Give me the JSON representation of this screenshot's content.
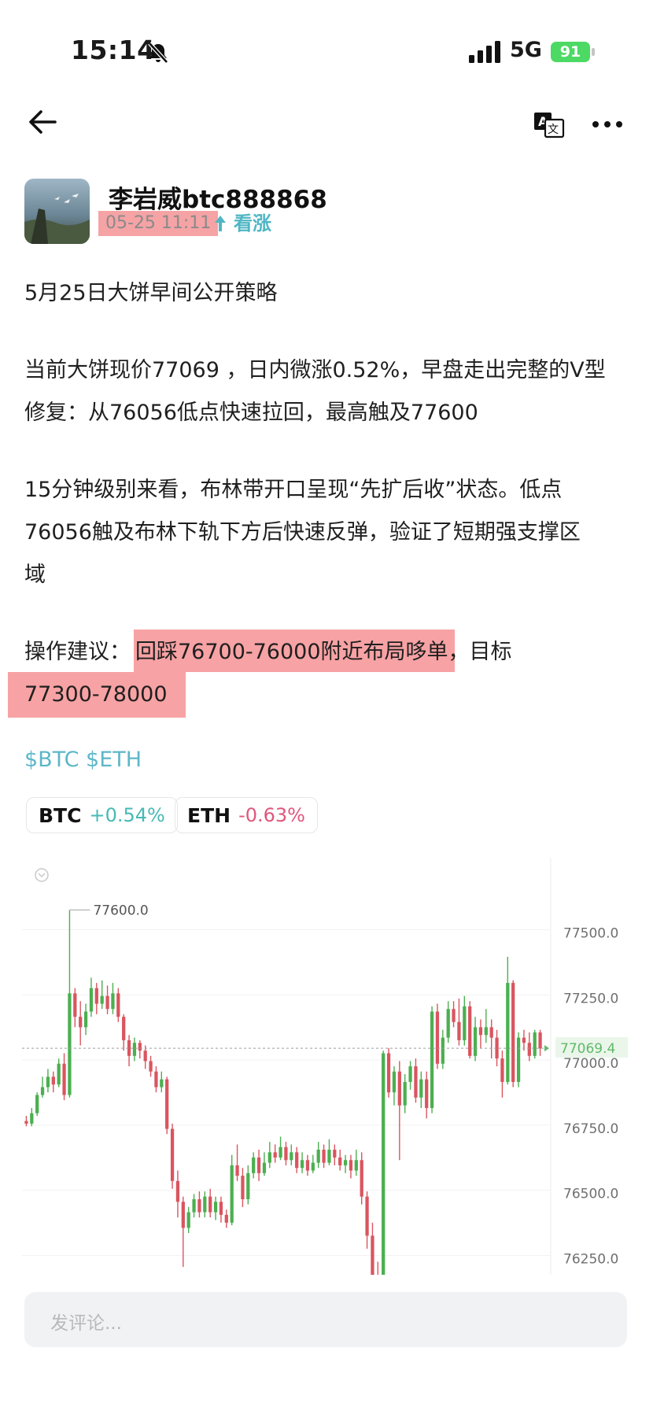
{
  "status_bar": {
    "time": "15:14",
    "network": "5G",
    "battery": "91"
  },
  "post": {
    "author": "李岩威btc888868",
    "time": "05-25 11:11",
    "sentiment": "看涨",
    "title_line": "5月25日大饼早间公开策略",
    "lines": [
      "当前大饼现价77069 ，日内微涨0.52%，早盘走出完整的V型",
      "修复：从76056低点快速拉回，最高触及77600",
      "15分钟级别来看，布林带开口呈现“先扩后收”状态。低点",
      "76056触及布林下轨下方后快速反弹，验证了短期强支撑区",
      "域"
    ],
    "advice_prefix": "操作建议：",
    "advice_highlight": "回踩76700-76000附近布局哆单",
    "advice_suffix": "，目标",
    "advice_target": "77300-78000",
    "tags": "$BTC $ETH"
  },
  "tickers": [
    {
      "symbol": "BTC",
      "change": "+0.54%"
    },
    {
      "symbol": "ETH",
      "change": "-0.63%"
    }
  ],
  "chart_data": {
    "type": "candlestick",
    "y_ticks": [
      "77500.0",
      "77250.0",
      "77000.0",
      "76750.0",
      "76500.0",
      "76250.0"
    ],
    "ylim": [
      76200,
      77740
    ],
    "high_label": "77600.0",
    "current_price_label": "77069.4",
    "colors": {
      "up": "#4caf50",
      "down": "#d9555f",
      "current": "#61b96a"
    },
    "candles": [
      [
        76790,
        76780,
        76810,
        76770
      ],
      [
        76780,
        76820,
        76840,
        76770
      ],
      [
        76820,
        76890,
        76900,
        76810
      ],
      [
        76890,
        76920,
        76960,
        76880
      ],
      [
        76920,
        76960,
        76990,
        76900
      ],
      [
        76960,
        76930,
        76980,
        76900
      ],
      [
        76930,
        77010,
        77030,
        76920
      ],
      [
        77010,
        76890,
        77050,
        76870
      ],
      [
        76890,
        77280,
        77600,
        76880
      ],
      [
        77280,
        77190,
        77300,
        77150
      ],
      [
        77190,
        77150,
        77250,
        77080
      ],
      [
        77150,
        77210,
        77240,
        77120
      ],
      [
        77210,
        77300,
        77340,
        77190
      ],
      [
        77300,
        77240,
        77320,
        77200
      ],
      [
        77240,
        77270,
        77330,
        77220
      ],
      [
        77270,
        77220,
        77310,
        77200
      ],
      [
        77220,
        77280,
        77320,
        77200
      ],
      [
        77280,
        77190,
        77300,
        77170
      ],
      [
        77190,
        77100,
        77200,
        77060
      ],
      [
        77100,
        77040,
        77120,
        77000
      ],
      [
        77040,
        77090,
        77110,
        77020
      ],
      [
        77090,
        77060,
        77100,
        77030
      ],
      [
        77060,
        77020,
        77080,
        76990
      ],
      [
        77020,
        76980,
        77040,
        76960
      ],
      [
        76980,
        76920,
        77000,
        76900
      ],
      [
        76920,
        76950,
        76980,
        76900
      ],
      [
        76950,
        76760,
        76960,
        76740
      ],
      [
        76760,
        76560,
        76780,
        76530
      ],
      [
        76560,
        76480,
        76600,
        76420
      ],
      [
        76480,
        76380,
        76500,
        76230
      ],
      [
        76380,
        76440,
        76460,
        76360
      ],
      [
        76440,
        76490,
        76510,
        76420
      ],
      [
        76490,
        76440,
        76520,
        76420
      ],
      [
        76440,
        76500,
        76520,
        76420
      ],
      [
        76500,
        76440,
        76530,
        76420
      ],
      [
        76440,
        76480,
        76500,
        76410
      ],
      [
        76480,
        76430,
        76500,
        76400
      ],
      [
        76430,
        76400,
        76450,
        76380
      ],
      [
        76400,
        76620,
        76660,
        76390
      ],
      [
        76620,
        76580,
        76700,
        76560
      ],
      [
        76580,
        76490,
        76610,
        76460
      ],
      [
        76490,
        76590,
        76620,
        76470
      ],
      [
        76590,
        76650,
        76670,
        76570
      ],
      [
        76650,
        76590,
        76680,
        76560
      ],
      [
        76590,
        76630,
        76670,
        76580
      ],
      [
        76630,
        76670,
        76710,
        76610
      ],
      [
        76670,
        76650,
        76700,
        76630
      ],
      [
        76650,
        76690,
        76730,
        76640
      ],
      [
        76690,
        76640,
        76710,
        76620
      ],
      [
        76640,
        76670,
        76700,
        76620
      ],
      [
        76670,
        76610,
        76690,
        76590
      ],
      [
        76610,
        76640,
        76670,
        76590
      ],
      [
        76640,
        76600,
        76660,
        76580
      ],
      [
        76600,
        76630,
        76660,
        76590
      ],
      [
        76630,
        76680,
        76710,
        76610
      ],
      [
        76680,
        76630,
        76700,
        76610
      ],
      [
        76630,
        76680,
        76720,
        76620
      ],
      [
        76680,
        76650,
        76700,
        76620
      ],
      [
        76650,
        76620,
        76680,
        76600
      ],
      [
        76620,
        76640,
        76660,
        76590
      ],
      [
        76640,
        76600,
        76660,
        76570
      ],
      [
        76600,
        76640,
        76680,
        76580
      ],
      [
        76640,
        76500,
        76670,
        76470
      ],
      [
        76500,
        76350,
        76520,
        76300
      ],
      [
        76350,
        76200,
        76400,
        76180
      ],
      [
        76200,
        76190,
        76250,
        76180
      ],
      [
        76190,
        77050,
        77060,
        76180
      ],
      [
        77050,
        76900,
        77070,
        76880
      ],
      [
        76900,
        76980,
        77000,
        76850
      ],
      [
        76980,
        76850,
        77020,
        76640
      ],
      [
        76850,
        76940,
        76970,
        76820
      ],
      [
        76940,
        77000,
        77020,
        76910
      ],
      [
        77000,
        76880,
        77030,
        76860
      ],
      [
        76880,
        76950,
        76980,
        76840
      ],
      [
        76950,
        76840,
        76980,
        76800
      ],
      [
        76840,
        77210,
        77230,
        76820
      ],
      [
        77210,
        77010,
        77240,
        76990
      ],
      [
        77010,
        77110,
        77140,
        76990
      ],
      [
        77110,
        77220,
        77250,
        77090
      ],
      [
        77220,
        77170,
        77250,
        77150
      ],
      [
        77170,
        77100,
        77260,
        77080
      ],
      [
        77100,
        77230,
        77270,
        77080
      ],
      [
        77230,
        77040,
        77250,
        77030
      ],
      [
        77040,
        77150,
        77190,
        77020
      ],
      [
        77150,
        77120,
        77180,
        77070
      ],
      [
        77120,
        77150,
        77220,
        77090
      ],
      [
        77150,
        77110,
        77180,
        77030
      ],
      [
        77110,
        77030,
        77140,
        77000
      ],
      [
        77030,
        76940,
        77060,
        76880
      ],
      [
        76940,
        77320,
        77420,
        76930
      ],
      [
        77320,
        76940,
        77330,
        76920
      ],
      [
        76940,
        77110,
        77130,
        76920
      ],
      [
        77110,
        77090,
        77140,
        77060
      ],
      [
        77090,
        77040,
        77130,
        77020
      ],
      [
        77040,
        77130,
        77140,
        77030
      ],
      [
        77130,
        77069,
        77140,
        77040
      ]
    ]
  }
}
